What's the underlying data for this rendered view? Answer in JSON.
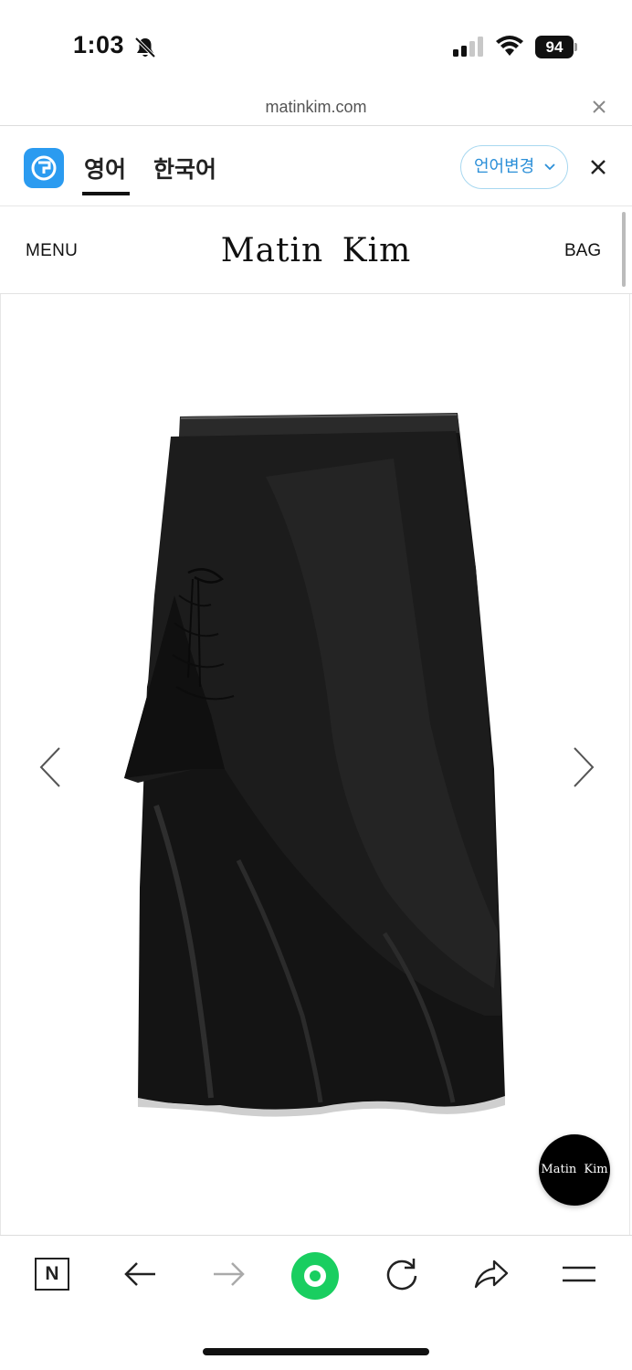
{
  "status_bar": {
    "time": "1:03",
    "battery": "94"
  },
  "url_bar": {
    "url": "matinkim.com"
  },
  "translate_bar": {
    "tabs": [
      {
        "label": "영어",
        "active": true
      },
      {
        "label": "한국어",
        "active": false
      }
    ],
    "change_language_label": "언어변경",
    "accent_color": "#2b9bf0"
  },
  "site_header": {
    "menu_label": "MENU",
    "brand": "Matin  Kim",
    "bag_label": "BAG"
  },
  "gallery": {
    "product_image": "black-layered-drawstring-skirt",
    "prev_icon": "chevron-left-icon",
    "next_icon": "chevron-right-icon",
    "chat_button_label": "Matin  Kim"
  },
  "toolbar": {
    "n_label": "N",
    "icons": [
      "naver-n-icon",
      "back-arrow-icon",
      "forward-arrow-icon",
      "green-ring-icon",
      "reload-icon",
      "share-icon",
      "hamburger-icon"
    ],
    "green_color": "#19ce60"
  }
}
